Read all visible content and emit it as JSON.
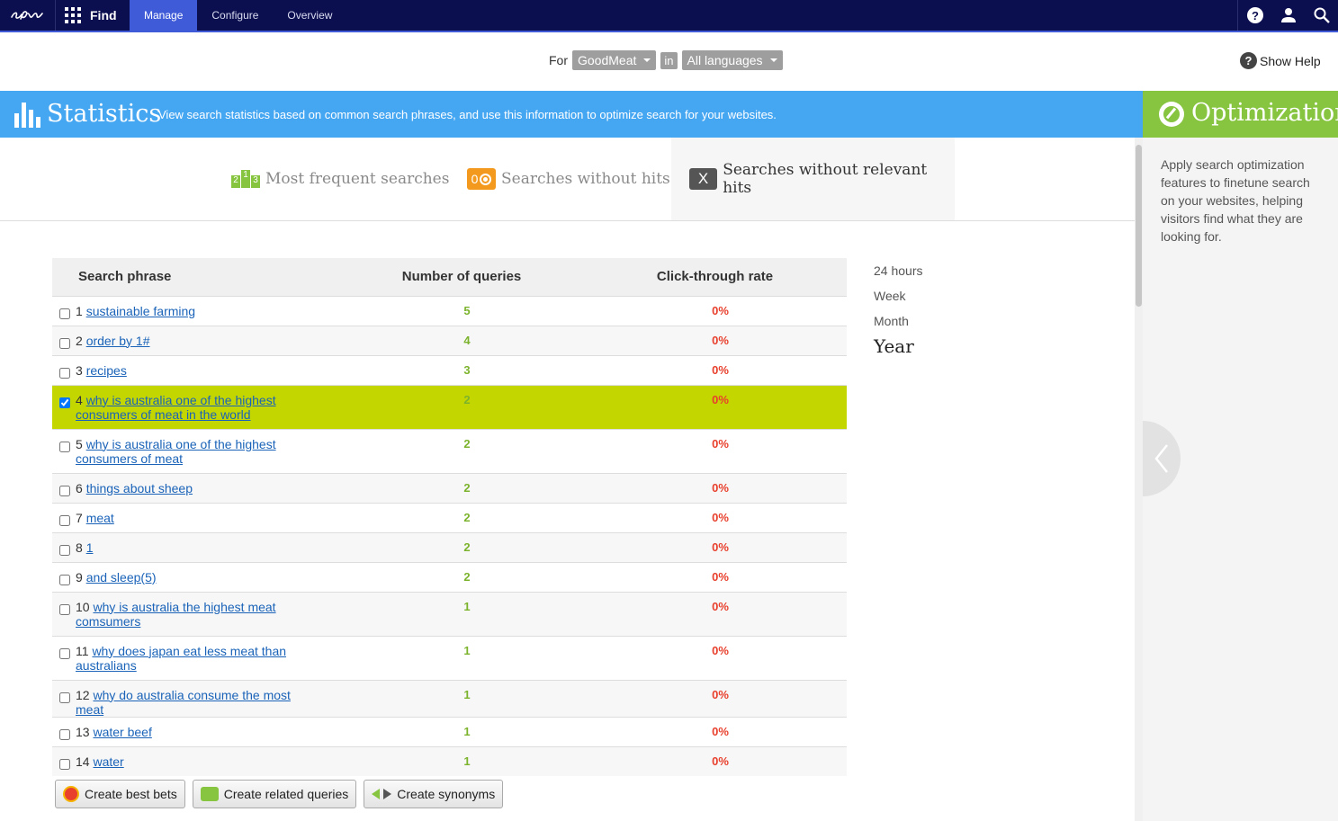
{
  "topbar": {
    "app_name": "Find",
    "tabs": [
      {
        "label": "Manage",
        "active": true
      },
      {
        "label": "Configure",
        "active": false
      },
      {
        "label": "Overview",
        "active": false
      }
    ],
    "icons": [
      "help-icon",
      "user-icon",
      "search-icon"
    ]
  },
  "context": {
    "for_label": "For",
    "site": "GoodMeat",
    "in_label": "in",
    "language": "All languages",
    "show_help": "Show Help"
  },
  "statistics": {
    "title": "Statistics",
    "description": "View search statistics based on common search phrases, and use this information to optimize search for your websites."
  },
  "optimization": {
    "title": "Optimization",
    "description": "Apply search optimization features to finetune search on your websites, helping visitors find what they are looking for."
  },
  "subtabs": [
    {
      "label": "Most frequent searches",
      "badge": [
        "2",
        "1",
        "3"
      ],
      "active": false
    },
    {
      "label": "Searches without hits",
      "badge": "0",
      "active": false
    },
    {
      "label": "Searches without relevant hits",
      "badge": "X",
      "active": true
    }
  ],
  "table": {
    "headers": [
      "Search phrase",
      "Number of queries",
      "Click-through rate"
    ],
    "rows": [
      {
        "rank": "1",
        "phrase": "sustainable farming",
        "queries": "5",
        "ctr": "0%",
        "checked": false
      },
      {
        "rank": "2",
        "phrase": " order by 1#",
        "queries": "4",
        "ctr": "0%",
        "checked": false
      },
      {
        "rank": "3",
        "phrase": "recipes",
        "queries": "3",
        "ctr": "0%",
        "checked": false
      },
      {
        "rank": "4",
        "phrase": "why is australia one of the highest consumers of meat in the world",
        "queries": "2",
        "ctr": "0%",
        "checked": true
      },
      {
        "rank": "5",
        "phrase": "why is australia one of the highest consumers of meat",
        "queries": "2",
        "ctr": "0%",
        "checked": false
      },
      {
        "rank": "6",
        "phrase": "things about sheep",
        "queries": "2",
        "ctr": "0%",
        "checked": false
      },
      {
        "rank": "7",
        "phrase": "meat",
        "queries": "2",
        "ctr": "0%",
        "checked": false
      },
      {
        "rank": "8",
        "phrase": "1",
        "queries": "2",
        "ctr": "0%",
        "checked": false
      },
      {
        "rank": "9",
        "phrase": " and sleep(5)",
        "queries": "2",
        "ctr": "0%",
        "checked": false
      },
      {
        "rank": "10",
        "phrase": "why is australia the highest meat comsumers",
        "queries": "1",
        "ctr": "0%",
        "checked": false
      },
      {
        "rank": "11",
        "phrase": "why does japan eat less meat than australians",
        "queries": "1",
        "ctr": "0%",
        "checked": false
      },
      {
        "rank": "12",
        "phrase": "why do australia consume the most meat",
        "queries": "1",
        "ctr": "0%",
        "checked": false
      },
      {
        "rank": "13",
        "phrase": "water beef",
        "queries": "1",
        "ctr": "0%",
        "checked": false
      },
      {
        "rank": "14",
        "phrase": "water",
        "queries": "1",
        "ctr": "0%",
        "checked": false
      }
    ]
  },
  "period": {
    "options": [
      "24 hours",
      "Week",
      "Month",
      "Year"
    ],
    "selected": "Year"
  },
  "actions": {
    "best_bets": "Create best bets",
    "related_queries": "Create related queries",
    "synonyms": "Create synonyms"
  }
}
